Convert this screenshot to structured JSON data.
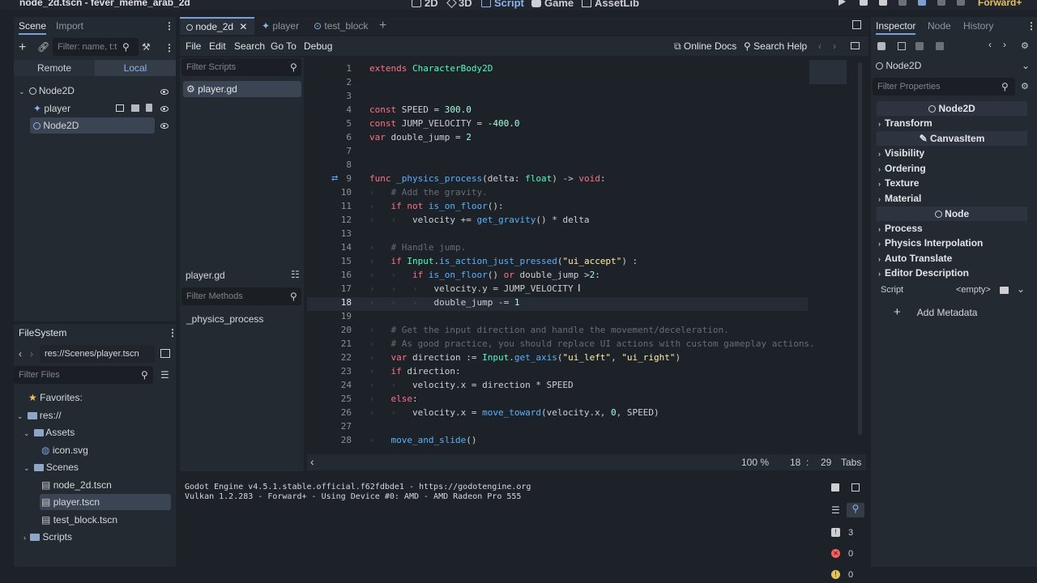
{
  "window": {
    "title": "node_2d.tscn - fever_meme_arab_2d"
  },
  "workspaces": [
    "2D",
    "3D",
    "Script",
    "Game",
    "AssetLib"
  ],
  "active_workspace": "Script",
  "renderer": "Forward+",
  "scene_dock": {
    "tabs": [
      "Scene",
      "Import"
    ],
    "filter_placeholder": "Filter: name, t:t",
    "remote_label": "Remote",
    "local_label": "Local",
    "tree": [
      {
        "label": "Node2D",
        "level": 0
      },
      {
        "label": "player",
        "level": 1
      },
      {
        "label": "Node2D",
        "level": 1
      }
    ]
  },
  "filesystem": {
    "title": "FileSystem",
    "path": "res://Scenes/player.tscn",
    "filter_placeholder": "Filter Files",
    "items": [
      {
        "label": "Favorites:",
        "kind": "fav"
      },
      {
        "label": "res://",
        "kind": "folder"
      },
      {
        "label": "Assets",
        "kind": "folder"
      },
      {
        "label": "icon.svg",
        "kind": "file"
      },
      {
        "label": "Scenes",
        "kind": "folder"
      },
      {
        "label": "node_2d.tscn",
        "kind": "file"
      },
      {
        "label": "player.tscn",
        "kind": "file"
      },
      {
        "label": "test_block.tscn",
        "kind": "file"
      },
      {
        "label": "Scripts",
        "kind": "folder"
      }
    ]
  },
  "editor_tabs": [
    {
      "label": "node_2d"
    },
    {
      "label": "player"
    },
    {
      "label": "test_block"
    }
  ],
  "script_menu": [
    "File",
    "Edit",
    "Search",
    "Go To",
    "Debug"
  ],
  "online_docs": "Online Docs",
  "search_help": "Search Help",
  "scripts_panel": {
    "filter_placeholder": "Filter Scripts",
    "scripts": [
      "player.gd"
    ],
    "current": "player.gd",
    "methods_placeholder": "Filter Methods",
    "methods": [
      "_physics_process"
    ]
  },
  "code": {
    "line_numbers": [
      "1",
      "2",
      "3",
      "4",
      "5",
      "6",
      "7",
      "8",
      "9",
      "10",
      "11",
      "12",
      "13",
      "14",
      "15",
      "16",
      "17",
      "18",
      "19",
      "20",
      "21",
      "22",
      "23",
      "24",
      "25",
      "26",
      "27",
      "28"
    ],
    "lines": [
      "extends CharacterBody2D",
      "",
      "",
      "const SPEED = 300.0",
      "const JUMP_VELOCITY = -400.0",
      "var double_jump = 2",
      "",
      "",
      "func _physics_process(delta: float) -> void:",
      "\t# Add the gravity.",
      "\tif not is_on_floor():",
      "\t\tvelocity += get_gravity() * delta",
      "",
      "\t# Handle jump.",
      "\tif Input.is_action_just_pressed(\"ui_accept\") :",
      "\t\tif is_on_floor() or double_jump >2:",
      "\t\t\tvelocity.y = JUMP_VELOCITY",
      "\t\t\tdouble_jump -= 1",
      "",
      "\t# Get the input direction and handle the movement/deceleration.",
      "\t# As good practice, you should replace UI actions with custom gameplay actions.",
      "\tvar direction := Input.get_axis(\"ui_left\", \"ui_right\")",
      "\tif direction:",
      "\t\tvelocity.x = direction * SPEED",
      "\telse:",
      "\t\tvelocity.x = move_toward(velocity.x, 0, SPEED)",
      "",
      "\tmove_and_slide()"
    ]
  },
  "status": {
    "zoom": "100 %",
    "line": "18",
    "sep": ":",
    "col": "29",
    "indent": "Tabs"
  },
  "output": {
    "lines": [
      "Godot Engine v4.5.1.stable.official.f62fdbde1 - https://godotengine.org",
      "Vulkan 1.2.283 - Forward+ - Using Device #0: AMD - AMD Radeon Pro 555"
    ],
    "counts": {
      "messages": "3",
      "errors": "0",
      "warnings": "0"
    }
  },
  "inspector": {
    "tabs": [
      "Inspector",
      "Node",
      "History"
    ],
    "object_name": "Node2D",
    "filter_placeholder": "Filter Properties",
    "header_node2d": "Node2D",
    "section_transform": "Transform",
    "header_canvas": "CanvasItem",
    "canvas_sections": [
      "Visibility",
      "Ordering",
      "Texture",
      "Material"
    ],
    "header_node": "Node",
    "node_sections": [
      "Process",
      "Physics Interpolation",
      "Auto Translate",
      "Editor Description"
    ],
    "script_label": "Script",
    "script_value": "<empty>",
    "add_metadata": "Add Metadata"
  }
}
